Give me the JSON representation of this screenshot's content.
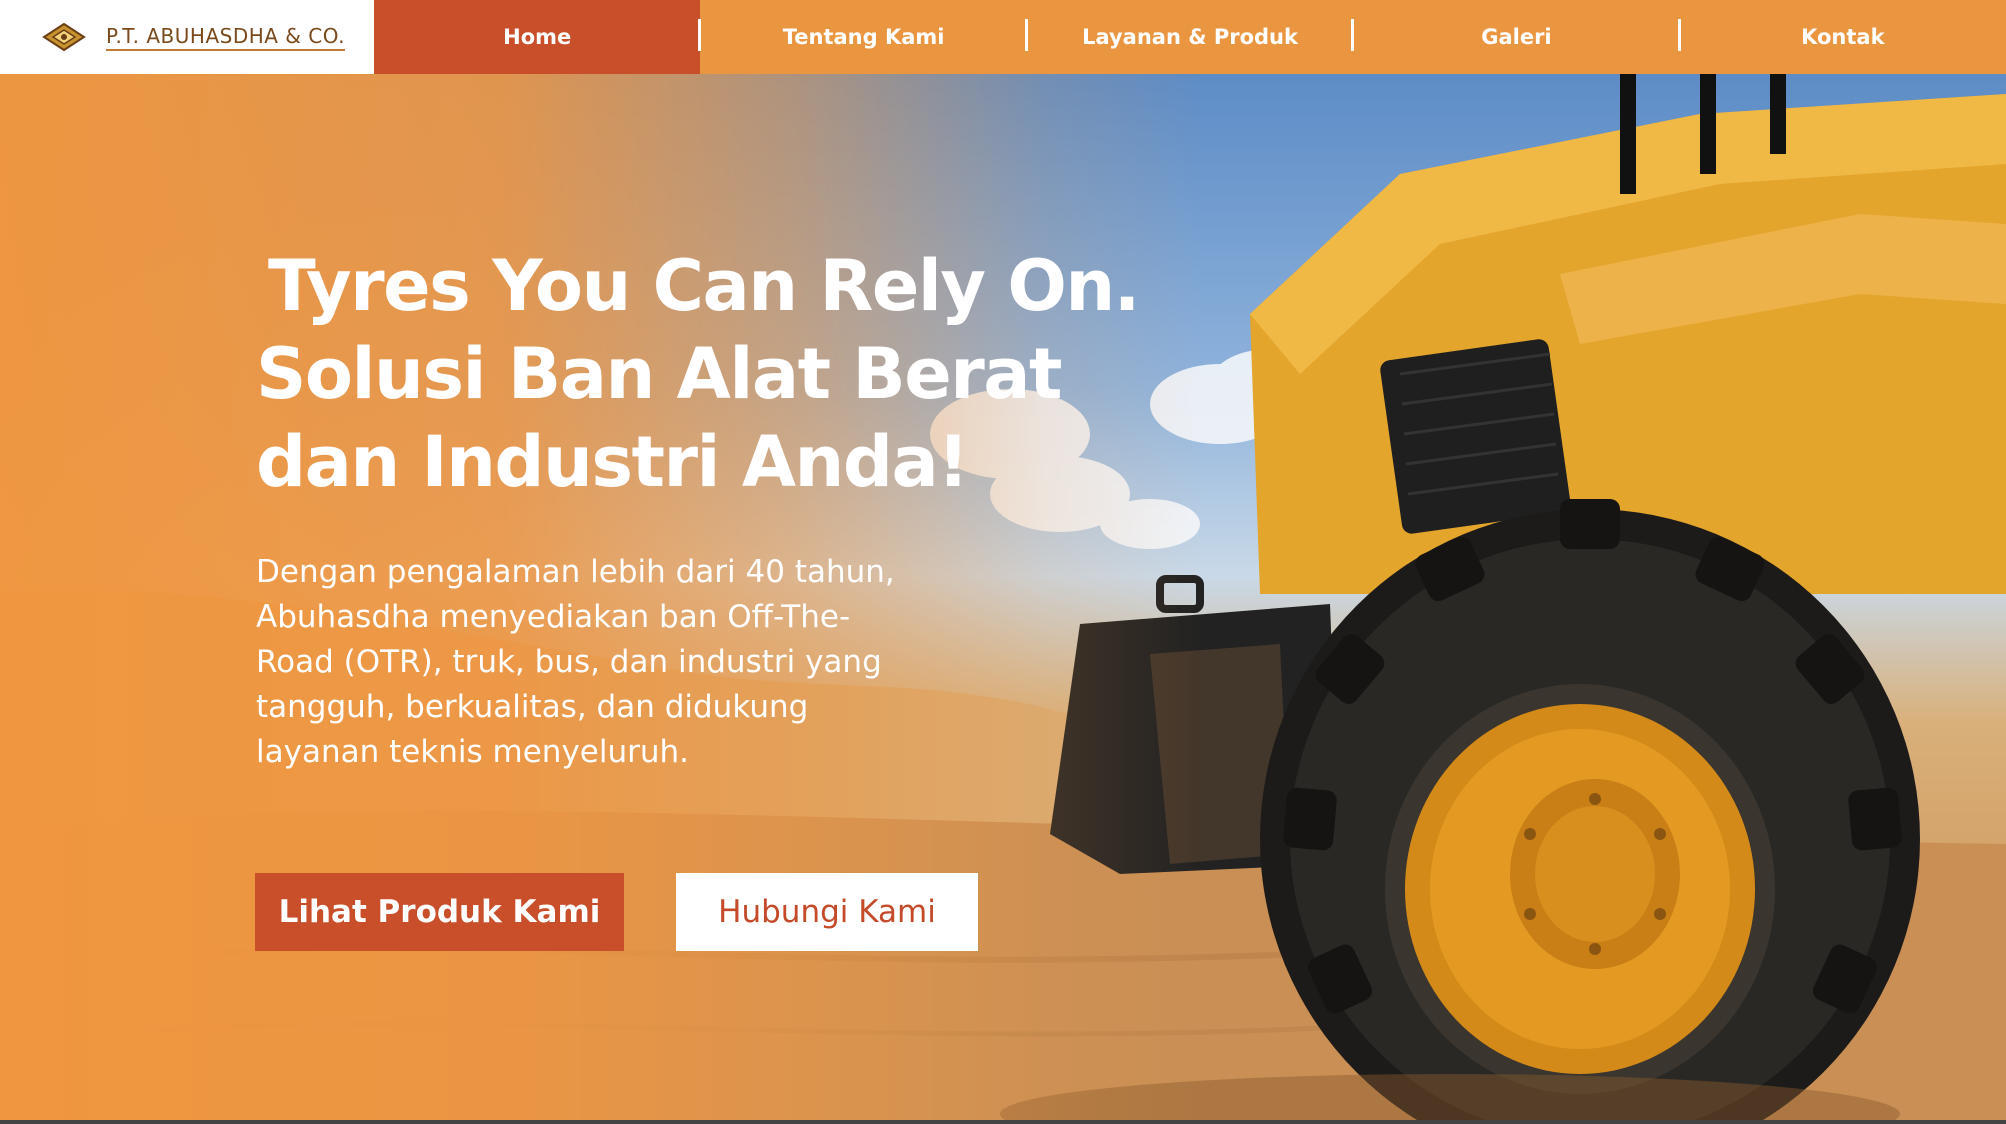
{
  "brand": {
    "name": "P.T. ABUHASDHA & CO.",
    "logo_icon": "diamond-emblem-icon"
  },
  "nav": {
    "items": [
      {
        "label": "Home",
        "active": true
      },
      {
        "label": "Tentang Kami",
        "active": false
      },
      {
        "label": "Layanan & Produk",
        "active": false
      },
      {
        "label": "Galeri",
        "active": false
      },
      {
        "label": "Kontak",
        "active": false
      }
    ]
  },
  "hero": {
    "headline": [
      "Tyres You Can Rely On.",
      "Solusi Ban Alat Berat",
      "dan Industri Anda!"
    ],
    "subtext": "Dengan pengalaman lebih dari 40 tahun, Abuhasdha menyediakan ban Off-The-Road (OTR), truk, bus, dan industri yang tangguh, berkualitas, dan didukung layanan teknis menyeluruh.",
    "primary_button": "Lihat Produk Kami",
    "secondary_button": "Hubungi Kami",
    "background_image": "wheel-loader-tyre-photo"
  },
  "colors": {
    "nav_bg": "#ea9640",
    "nav_active": "#c94f2b",
    "primary": "#c94f2b",
    "hero_overlay": "#ee9a48",
    "text_light": "#ffffff"
  }
}
